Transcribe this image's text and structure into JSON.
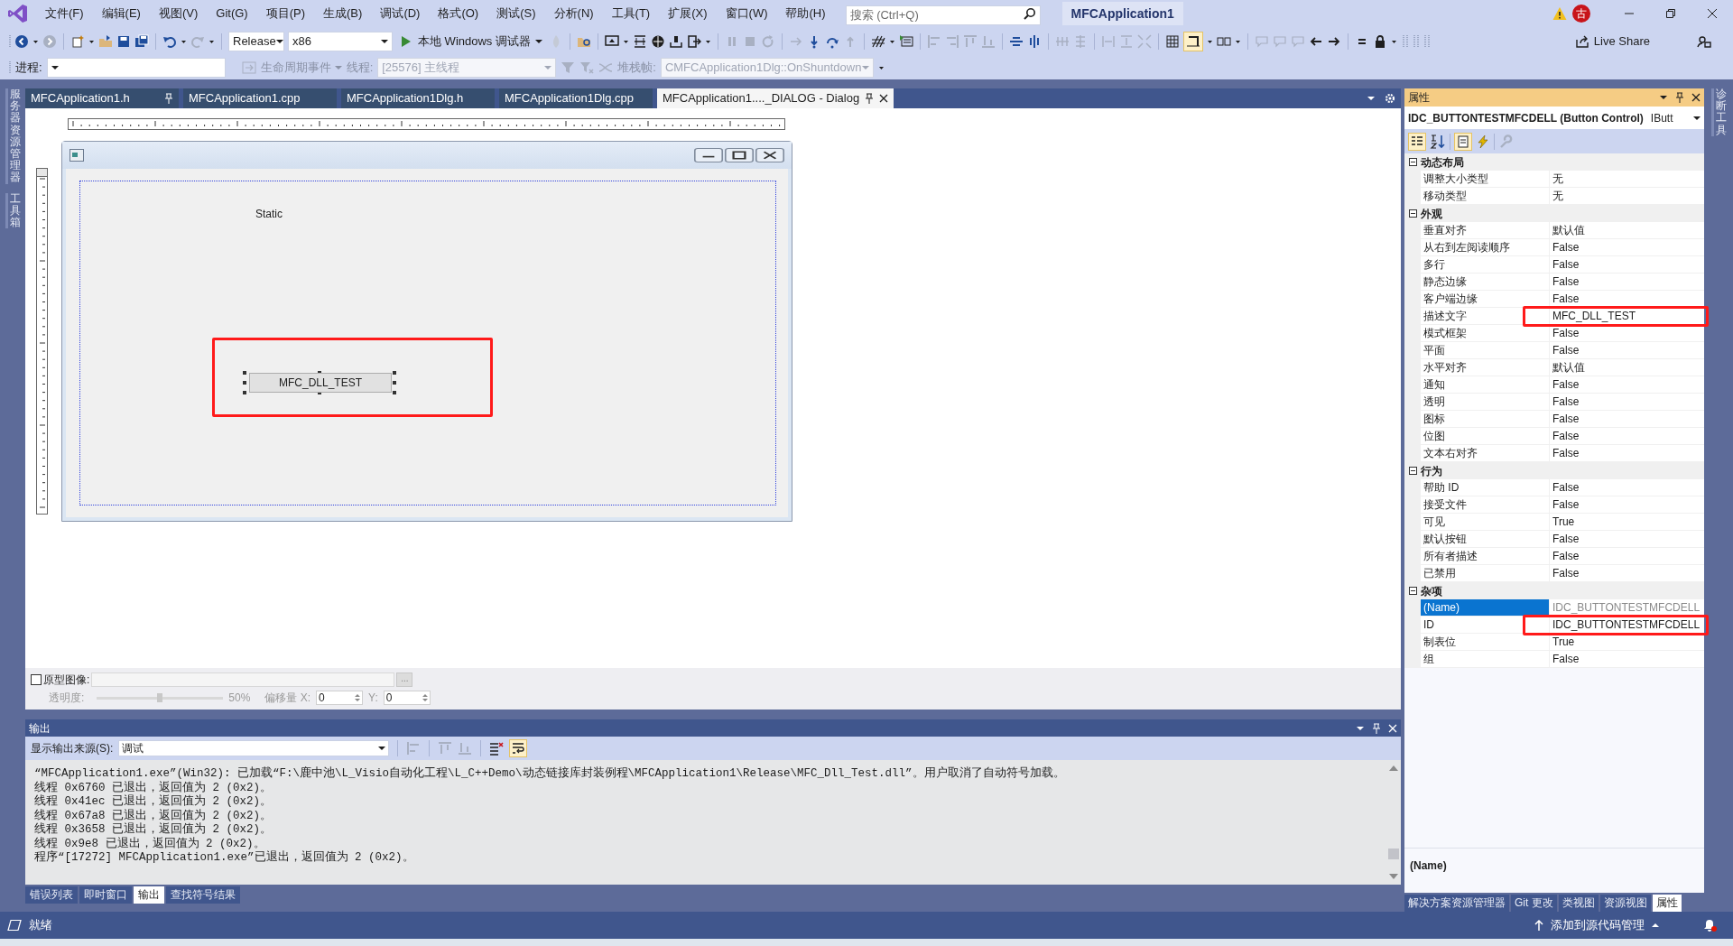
{
  "title_bar": {
    "menu": [
      "文件(F)",
      "编辑(E)",
      "视图(V)",
      "Git(G)",
      "项目(P)",
      "生成(B)",
      "调试(D)",
      "格式(O)",
      "测试(S)",
      "分析(N)",
      "工具(T)",
      "扩展(X)",
      "窗口(W)",
      "帮助(H)"
    ],
    "search": {
      "placeholder": "搜索 (Ctrl+Q)"
    },
    "solution_name": "MFCApplication1",
    "account_initial": "古"
  },
  "toolbar": {
    "configuration": "Release",
    "platform": "x86",
    "run_label": "本地 Windows 调试器",
    "live_share": "Live Share"
  },
  "debug_toolbar": {
    "process_label": "进程:",
    "lifecycle_label": "生命周期事件",
    "thread_label": "线程:",
    "thread_value": "[25576] 主线程",
    "stack_label": "堆栈帧:",
    "stack_value": "CMFCApplication1Dlg::OnShuntdown"
  },
  "left_rail": [
    "服务器资源管理器",
    "工具箱"
  ],
  "right_rail": [
    "诊断工具"
  ],
  "editor_tabs": [
    {
      "label": "MFCApplication1.h",
      "selected": false,
      "pinned": true
    },
    {
      "label": "MFCApplication1.cpp",
      "selected": false,
      "pinned": false
    },
    {
      "label": "MFCApplication1Dlg.h",
      "selected": false,
      "pinned": false
    },
    {
      "label": "MFCApplication1Dlg.cpp",
      "selected": false,
      "pinned": false
    },
    {
      "label": "MFCApplication1...._DIALOG - Dialog",
      "selected": true,
      "pinned": true
    }
  ],
  "dialog": {
    "static_text": "Static",
    "button_label": "MFC_DLL_TEST",
    "button_selected": true,
    "highlighted": true
  },
  "prototype": {
    "checkbox_label": "原型图像:",
    "checked": false,
    "browse_label": "...",
    "opacity_label": "透明度:",
    "level": 0.5,
    "opacity_reading": "50%",
    "offset_label": "偏移量 X:",
    "x_value": "0",
    "y_label": "Y:",
    "y_value": "0"
  },
  "output": {
    "title": "输出",
    "source_label": "显示输出来源(S):",
    "source_value": "调试",
    "word_wrap": true,
    "lines": [
      "“MFCApplication1.exe”(Win32): 已加载“F:\\鹿中池\\L_Visio自动化工程\\L_C++Demo\\动态链接库封装例程\\MFCApplication1\\Release\\MFC_Dll_Test.dll”。用户取消了自动符号加载。",
      "线程 0x6760 已退出，返回值为 2 (0x2)。",
      "线程 0x41ec 已退出，返回值为 2 (0x2)。",
      "线程 0x67a8 已退出，返回值为 2 (0x2)。",
      "线程 0x3658 已退出，返回值为 2 (0x2)。",
      "线程 0x9e8 已退出，返回值为 2 (0x2)。",
      "程序“[17272] MFCApplication1.exe”已退出，返回值为 2 (0x2)。"
    ]
  },
  "bottom_tabs_left": [
    {
      "label": "错误列表",
      "selected": false
    },
    {
      "label": "即时窗口",
      "selected": false
    },
    {
      "label": "输出",
      "selected": true
    },
    {
      "label": "查找符号结果",
      "selected": false
    }
  ],
  "properties": {
    "title": "属性",
    "object": "IDC_BUTTONTESTMFCDELL (Button Control)",
    "object_type": "IButt",
    "categories": [
      {
        "name": "动态布局",
        "expanded": true,
        "rows": [
          {
            "name": "调整大小类型",
            "value": "无",
            "selected": false,
            "readonly": false,
            "highlighted": false
          },
          {
            "name": "移动类型",
            "value": "无",
            "selected": false,
            "readonly": false,
            "highlighted": false
          }
        ]
      },
      {
        "name": "外观",
        "expanded": true,
        "rows": [
          {
            "name": "垂直对齐",
            "value": "默认值",
            "selected": false,
            "readonly": false,
            "highlighted": false
          },
          {
            "name": "从右到左阅读顺序",
            "value": "False",
            "selected": false,
            "readonly": false,
            "highlighted": false
          },
          {
            "name": "多行",
            "value": "False",
            "selected": false,
            "readonly": false,
            "highlighted": false
          },
          {
            "name": "静态边缘",
            "value": "False",
            "selected": false,
            "readonly": false,
            "highlighted": false
          },
          {
            "name": "客户端边缘",
            "value": "False",
            "selected": false,
            "readonly": false,
            "highlighted": false
          },
          {
            "name": "描述文字",
            "value": "MFC_DLL_TEST",
            "selected": false,
            "readonly": false,
            "highlighted": true
          },
          {
            "name": "模式框架",
            "value": "False",
            "selected": false,
            "readonly": false,
            "highlighted": false
          },
          {
            "name": "平面",
            "value": "False",
            "selected": false,
            "readonly": false,
            "highlighted": false
          },
          {
            "name": "水平对齐",
            "value": "默认值",
            "selected": false,
            "readonly": false,
            "highlighted": false
          },
          {
            "name": "通知",
            "value": "False",
            "selected": false,
            "readonly": false,
            "highlighted": false
          },
          {
            "name": "透明",
            "value": "False",
            "selected": false,
            "readonly": false,
            "highlighted": false
          },
          {
            "name": "图标",
            "value": "False",
            "selected": false,
            "readonly": false,
            "highlighted": false
          },
          {
            "name": "位图",
            "value": "False",
            "selected": false,
            "readonly": false,
            "highlighted": false
          },
          {
            "name": "文本右对齐",
            "value": "False",
            "selected": false,
            "readonly": false,
            "highlighted": false
          }
        ]
      },
      {
        "name": "行为",
        "expanded": true,
        "rows": [
          {
            "name": "帮助 ID",
            "value": "False",
            "selected": false,
            "readonly": false,
            "highlighted": false
          },
          {
            "name": "接受文件",
            "value": "False",
            "selected": false,
            "readonly": false,
            "highlighted": false
          },
          {
            "name": "可见",
            "value": "True",
            "selected": false,
            "readonly": false,
            "highlighted": false
          },
          {
            "name": "默认按钮",
            "value": "False",
            "selected": false,
            "readonly": false,
            "highlighted": false
          },
          {
            "name": "所有者描述",
            "value": "False",
            "selected": false,
            "readonly": false,
            "highlighted": false
          },
          {
            "name": "已禁用",
            "value": "False",
            "selected": false,
            "readonly": false,
            "highlighted": false
          }
        ]
      },
      {
        "name": "杂项",
        "expanded": true,
        "rows": [
          {
            "name": "(Name)",
            "value": "IDC_BUTTONTESTMFCDELL",
            "selected": true,
            "readonly": true,
            "highlighted": false
          },
          {
            "name": "ID",
            "value": "IDC_BUTTONTESTMFCDELL",
            "selected": false,
            "readonly": false,
            "highlighted": true
          },
          {
            "name": "制表位",
            "value": "True",
            "selected": false,
            "readonly": false,
            "highlighted": false
          },
          {
            "name": "组",
            "value": "False",
            "selected": false,
            "readonly": false,
            "highlighted": false
          }
        ]
      }
    ],
    "description_title": "(Name)"
  },
  "bottom_tabs_right": [
    {
      "label": "解决方案资源管理器",
      "selected": false
    },
    {
      "label": "Git 更改",
      "selected": false
    },
    {
      "label": "类视图",
      "selected": false
    },
    {
      "label": "资源视图",
      "selected": false
    },
    {
      "label": "属性",
      "selected": true
    }
  ],
  "status_bar": {
    "text": "就绪",
    "source_control": "添加到源代码管理"
  }
}
